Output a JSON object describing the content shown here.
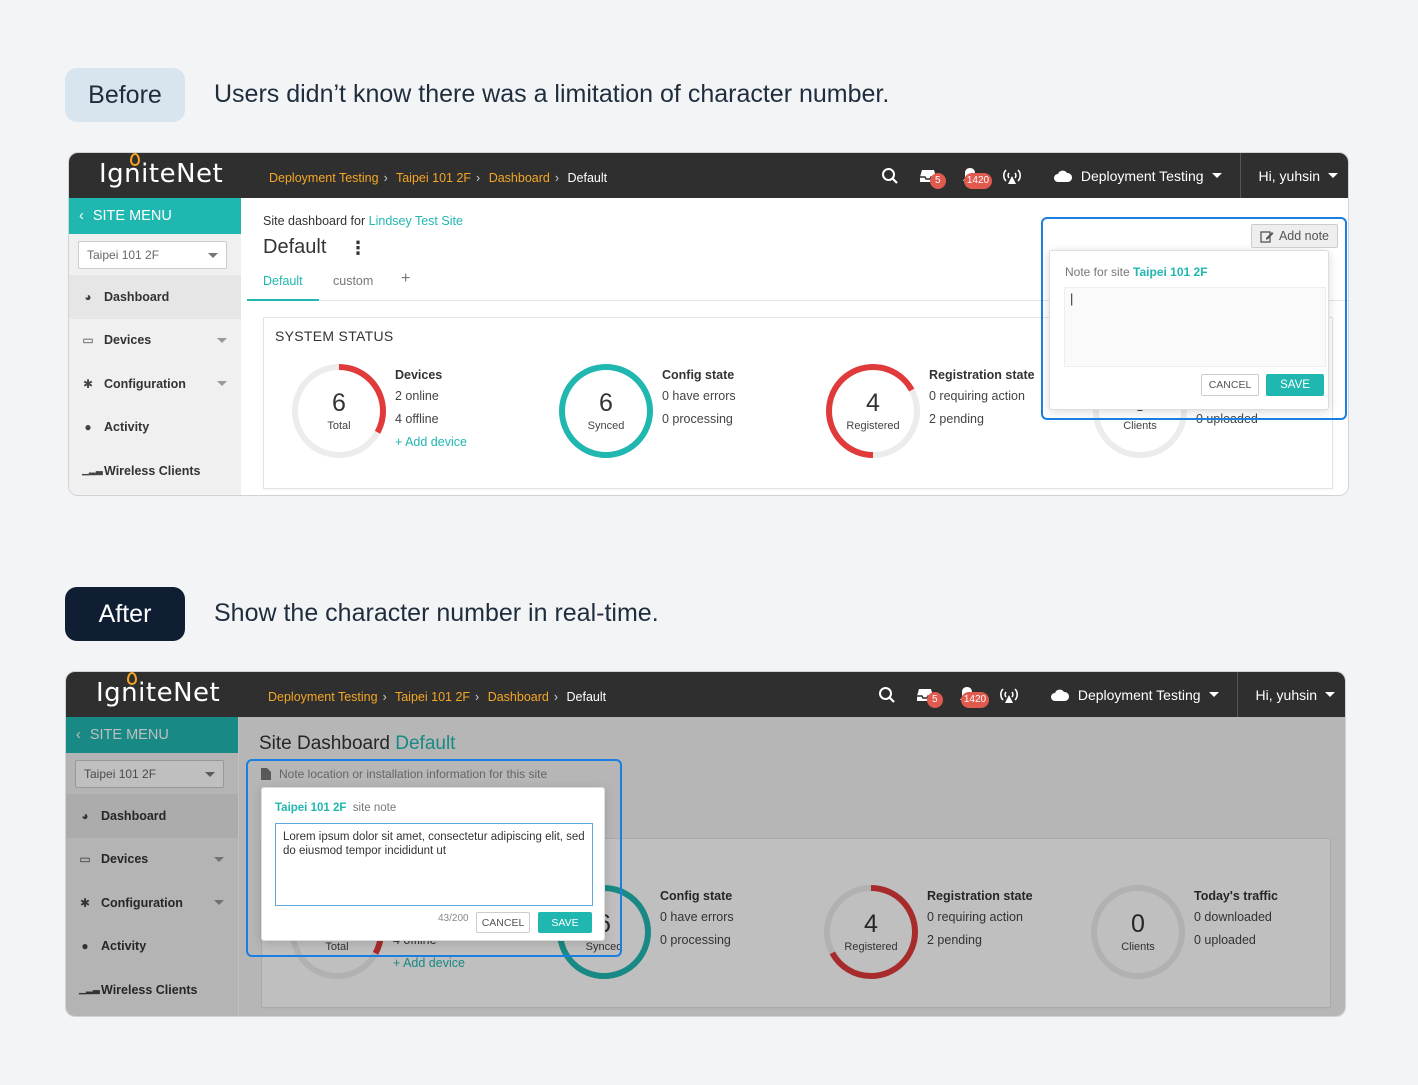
{
  "before": {
    "label": "Before",
    "caption": "Users didn’t know there was a limitation of character number.",
    "topbar": {
      "logo": "IgniteNet",
      "crumbs": [
        "Deployment Testing",
        "Taipei 101 2F",
        "Dashboard",
        "Default"
      ],
      "inbox_badge": "5",
      "alerts_badge": "1420",
      "account": "Deployment Testing",
      "user": "Hi, yuhsin"
    },
    "sidebar": {
      "header": "SITE MENU",
      "site_select": "Taipei 101 2F",
      "items": [
        "Dashboard",
        "Devices",
        "Configuration",
        "Activity",
        "Wireless Clients"
      ]
    },
    "main": {
      "subtitle_prefix": "Site dashboard for",
      "subtitle_link": "Lindsey Test Site",
      "title": "Default",
      "kebab": "⋮",
      "tabs": [
        "Default",
        "custom",
        "+"
      ],
      "panel_title": "SYSTEM STATUS"
    },
    "stats": {
      "devices": {
        "value": "6",
        "label": "Total",
        "title": "Devices",
        "l1": "2 online",
        "l2": "4 offline",
        "link": "+ Add device",
        "fraction": 0.33
      },
      "config": {
        "value": "6",
        "label": "Synced",
        "title": "Config state",
        "l1": "0 have errors",
        "l2": "0 processing",
        "fraction": 1.0
      },
      "registration": {
        "value": "4",
        "label": "Registered",
        "title": "Registration state",
        "l1": "0 requiring action",
        "l2": "2 pending",
        "fraction": 0.67
      },
      "clients": {
        "value": "0",
        "label": "Clients",
        "l2": "0 uploaded"
      }
    },
    "note": {
      "button": "Add note",
      "title_prefix": "Note for site",
      "title_site": "Taipei 101 2F",
      "text": "|",
      "cancel": "CANCEL",
      "save": "SAVE"
    }
  },
  "after": {
    "label": "After",
    "caption": "Show the character number in real-time.",
    "topbar": {
      "logo": "IgniteNet",
      "crumbs": [
        "Deployment Testing",
        "Taipei 101 2F",
        "Dashboard",
        "Default"
      ],
      "inbox_badge": "5",
      "alerts_badge": "1420",
      "account": "Deployment Testing",
      "user": "Hi, yuhsin"
    },
    "sidebar": {
      "header": "SITE MENU",
      "site_select": "Taipei 101 2F",
      "items": [
        "Dashboard",
        "Devices",
        "Configuration",
        "Activity",
        "Wireless Clients"
      ]
    },
    "main": {
      "title_prefix": "Site Dashboard",
      "title_accent": "Default",
      "note_hint": "Note location or installation information for this site"
    },
    "stats": {
      "devices": {
        "label": "Total",
        "l1": "4 offline",
        "link": "+ Add device",
        "fraction": 0.33
      },
      "config": {
        "value": "6",
        "label": "Synced",
        "title": "Config state",
        "l1": "0 have errors",
        "l2": "0 processing",
        "fraction": 1.0
      },
      "registration": {
        "value": "4",
        "label": "Registered",
        "title": "Registration state",
        "l1": "0 requiring action",
        "l2": "2 pending",
        "fraction": 0.67
      },
      "traffic": {
        "value": "0",
        "label": "Clients",
        "title": "Today's traffic",
        "l1": "0 downloaded",
        "l2": "0 uploaded",
        "fraction": 0
      }
    },
    "note": {
      "title_site": "Taipei 101 2F",
      "title_suffix": "site note",
      "text": "Lorem ipsum dolor sit amet, consectetur adipiscing elit, sed do eiusmod tempor incididunt ut",
      "counter": "43/200",
      "cancel": "CANCEL",
      "save": "SAVE"
    }
  },
  "colors": {
    "teal": "#20b7b0",
    "red": "#e03a3a",
    "orange": "#f5a623",
    "highlight": "#1a7fe0",
    "dark": "#2f2f2f"
  }
}
